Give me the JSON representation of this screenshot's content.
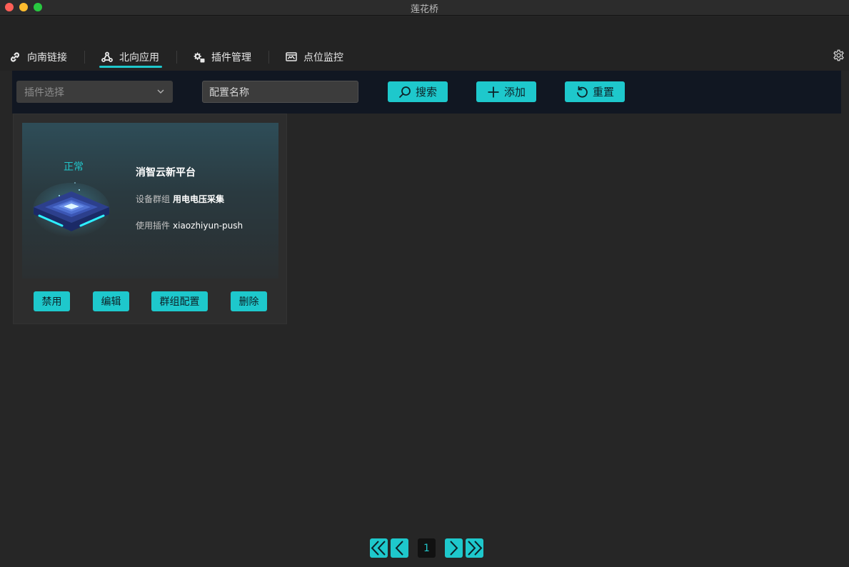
{
  "window": {
    "title": "莲花桥"
  },
  "nav": {
    "tabs": [
      {
        "label": "向南链接",
        "icon": "link-icon"
      },
      {
        "label": "北向应用",
        "icon": "apps-icon",
        "active": true
      },
      {
        "label": "插件管理",
        "icon": "plugin-icon"
      },
      {
        "label": "点位监控",
        "icon": "monitor-icon"
      }
    ],
    "settings_icon": "gear-icon"
  },
  "toolbar": {
    "plugin_select": {
      "placeholder": "插件选择",
      "icon": "chevron-down-icon"
    },
    "name_input": {
      "value": "配置名称"
    },
    "search_label": "搜索",
    "add_label": "添加",
    "reset_label": "重置"
  },
  "cards": [
    {
      "status": "正常",
      "title": "消智云新平台",
      "group_label": "设备群组",
      "group_value": "用电电压采集",
      "plugin_label": "使用插件",
      "plugin_value": "xiaozhiyun-push",
      "buttons": {
        "disable": "禁用",
        "edit": "编辑",
        "group_config": "群组配置",
        "delete": "删除"
      }
    }
  ],
  "pagination": {
    "current": "1"
  },
  "colors": {
    "accent": "#1ec8cc",
    "toolbar_bg": "#111722",
    "page_bg": "#262626"
  }
}
